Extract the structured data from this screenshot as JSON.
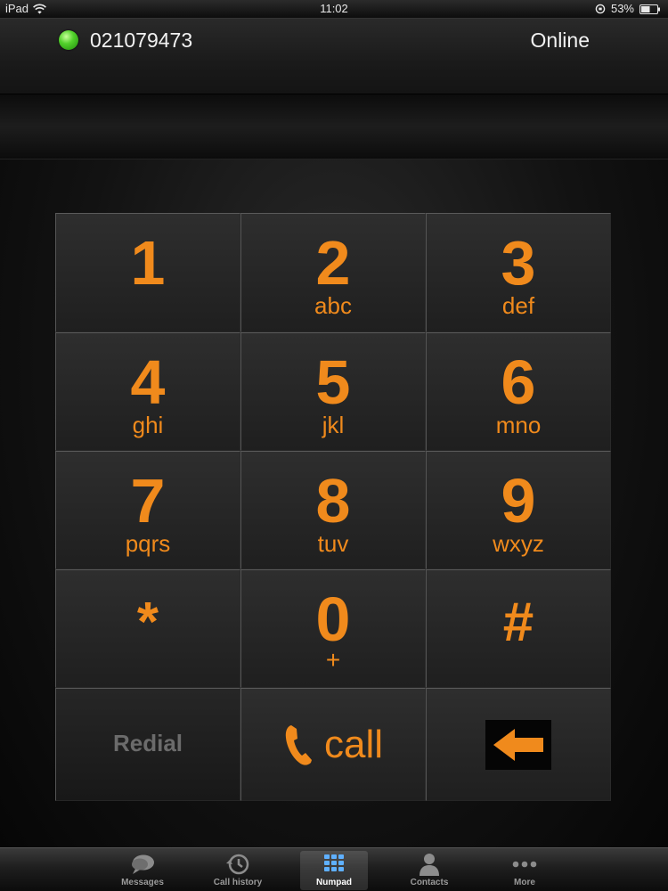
{
  "statusbar": {
    "device": "iPad",
    "time": "11:02",
    "battery": "53%"
  },
  "account": {
    "number": "021079473",
    "status": "Online",
    "status_color": "#52d12b"
  },
  "keypad": {
    "accent_color": "#f08a1c",
    "keys": [
      {
        "digit": "1",
        "letters": ""
      },
      {
        "digit": "2",
        "letters": "abc"
      },
      {
        "digit": "3",
        "letters": "def"
      },
      {
        "digit": "4",
        "letters": "ghi"
      },
      {
        "digit": "5",
        "letters": "jkl"
      },
      {
        "digit": "6",
        "letters": "mno"
      },
      {
        "digit": "7",
        "letters": "pqrs"
      },
      {
        "digit": "8",
        "letters": "tuv"
      },
      {
        "digit": "9",
        "letters": "wxyz"
      },
      {
        "digit": "*",
        "letters": ""
      },
      {
        "digit": "0",
        "letters": "+"
      },
      {
        "digit": "#",
        "letters": ""
      }
    ],
    "redial_label": "Redial",
    "call_label": "call",
    "call_icon": "phone-icon",
    "backspace_icon": "arrow-left-icon"
  },
  "tabbar": {
    "active": "Numpad",
    "tabs": [
      {
        "label": "Messages",
        "icon": "speech-bubble-icon"
      },
      {
        "label": "Call history",
        "icon": "clock-history-icon"
      },
      {
        "label": "Numpad",
        "icon": "keypad-grid-icon"
      },
      {
        "label": "Contacts",
        "icon": "person-icon"
      },
      {
        "label": "More",
        "icon": "dots-icon"
      }
    ]
  }
}
